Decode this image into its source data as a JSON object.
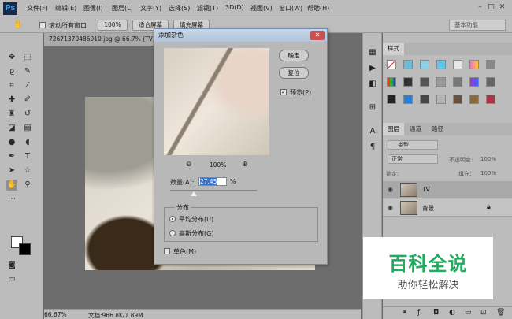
{
  "app": {
    "logo": "Ps"
  },
  "menu": [
    "文件(F)",
    "编辑(E)",
    "图像(I)",
    "图层(L)",
    "文字(Y)",
    "选择(S)",
    "滤镜(T)",
    "3D(D)",
    "视图(V)",
    "窗口(W)",
    "帮助(H)"
  ],
  "options_bar": {
    "scroll_all_label": "滚动所有窗口",
    "zoom_100": "100%",
    "fit_screen": "适合屏幕",
    "fill_screen": "填充屏幕",
    "workspace": "基本功能"
  },
  "document": {
    "tab_title": "72671370486910.jpg @ 66.7% (TV, R",
    "zoom": "66.67%",
    "doc_info": "文档:966.8K/1.89M"
  },
  "dialog": {
    "title": "添加杂色",
    "ok": "确定",
    "reset": "复位",
    "preview_label": "预览(P)",
    "preview_zoom": "100%",
    "amount_label": "数量(A):",
    "amount_value": "27.45",
    "amount_unit": "%",
    "amount_fraction": 0.2745,
    "distribution_label": "分布",
    "uniform": "平均分布(U)",
    "gaussian": "高斯分布(G)",
    "mono": "单色(M)"
  },
  "panels": {
    "styles_tab": "样式",
    "layers_tab": "图层",
    "channels_tab": "通道",
    "paths_tab": "路径",
    "kind_filter": "类型",
    "blend_mode": "正常",
    "opacity_label": "不透明度:",
    "opacity_value": "100%",
    "lock_label": "锁定:",
    "fill_label": "填充:",
    "fill_value": "100%",
    "layers": [
      {
        "name": "TV",
        "selected": true
      },
      {
        "name": "背景",
        "selected": false
      }
    ]
  },
  "watermark": {
    "title": "百科全说",
    "subtitle": "助你轻松解决"
  }
}
